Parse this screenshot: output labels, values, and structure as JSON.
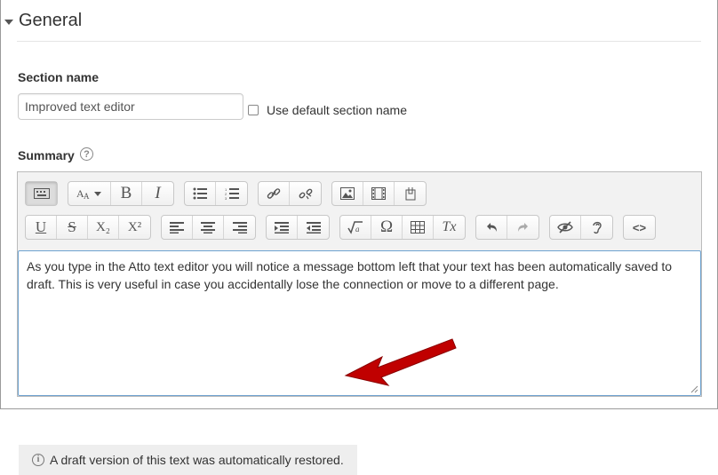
{
  "fieldset": {
    "legend": "General"
  },
  "section_name": {
    "label": "Section name",
    "value": "Improved text editor",
    "default_checkbox_label": "Use default section name",
    "default_checked": false
  },
  "summary": {
    "label": "Summary",
    "help_icon": "question-circle-icon",
    "content": "As you type in the Atto text editor you will notice a message bottom left that your text has been automatically saved to draft. This is very useful in case you accidentally lose the connection or move to a different page.",
    "notice": "A draft version of this text was automatically restored."
  },
  "toolbar": {
    "bold": "B",
    "italic": "I",
    "underline": "U",
    "strikethrough": "S",
    "subscript": "X₂",
    "superscript": "X²",
    "omega": "Ω",
    "clear_formatting": "Tx",
    "html": "<>"
  },
  "colors": {
    "content_border": "#6ea2d0",
    "arrow": "#c00000",
    "toolbar_bg": "#f2f2f2"
  }
}
